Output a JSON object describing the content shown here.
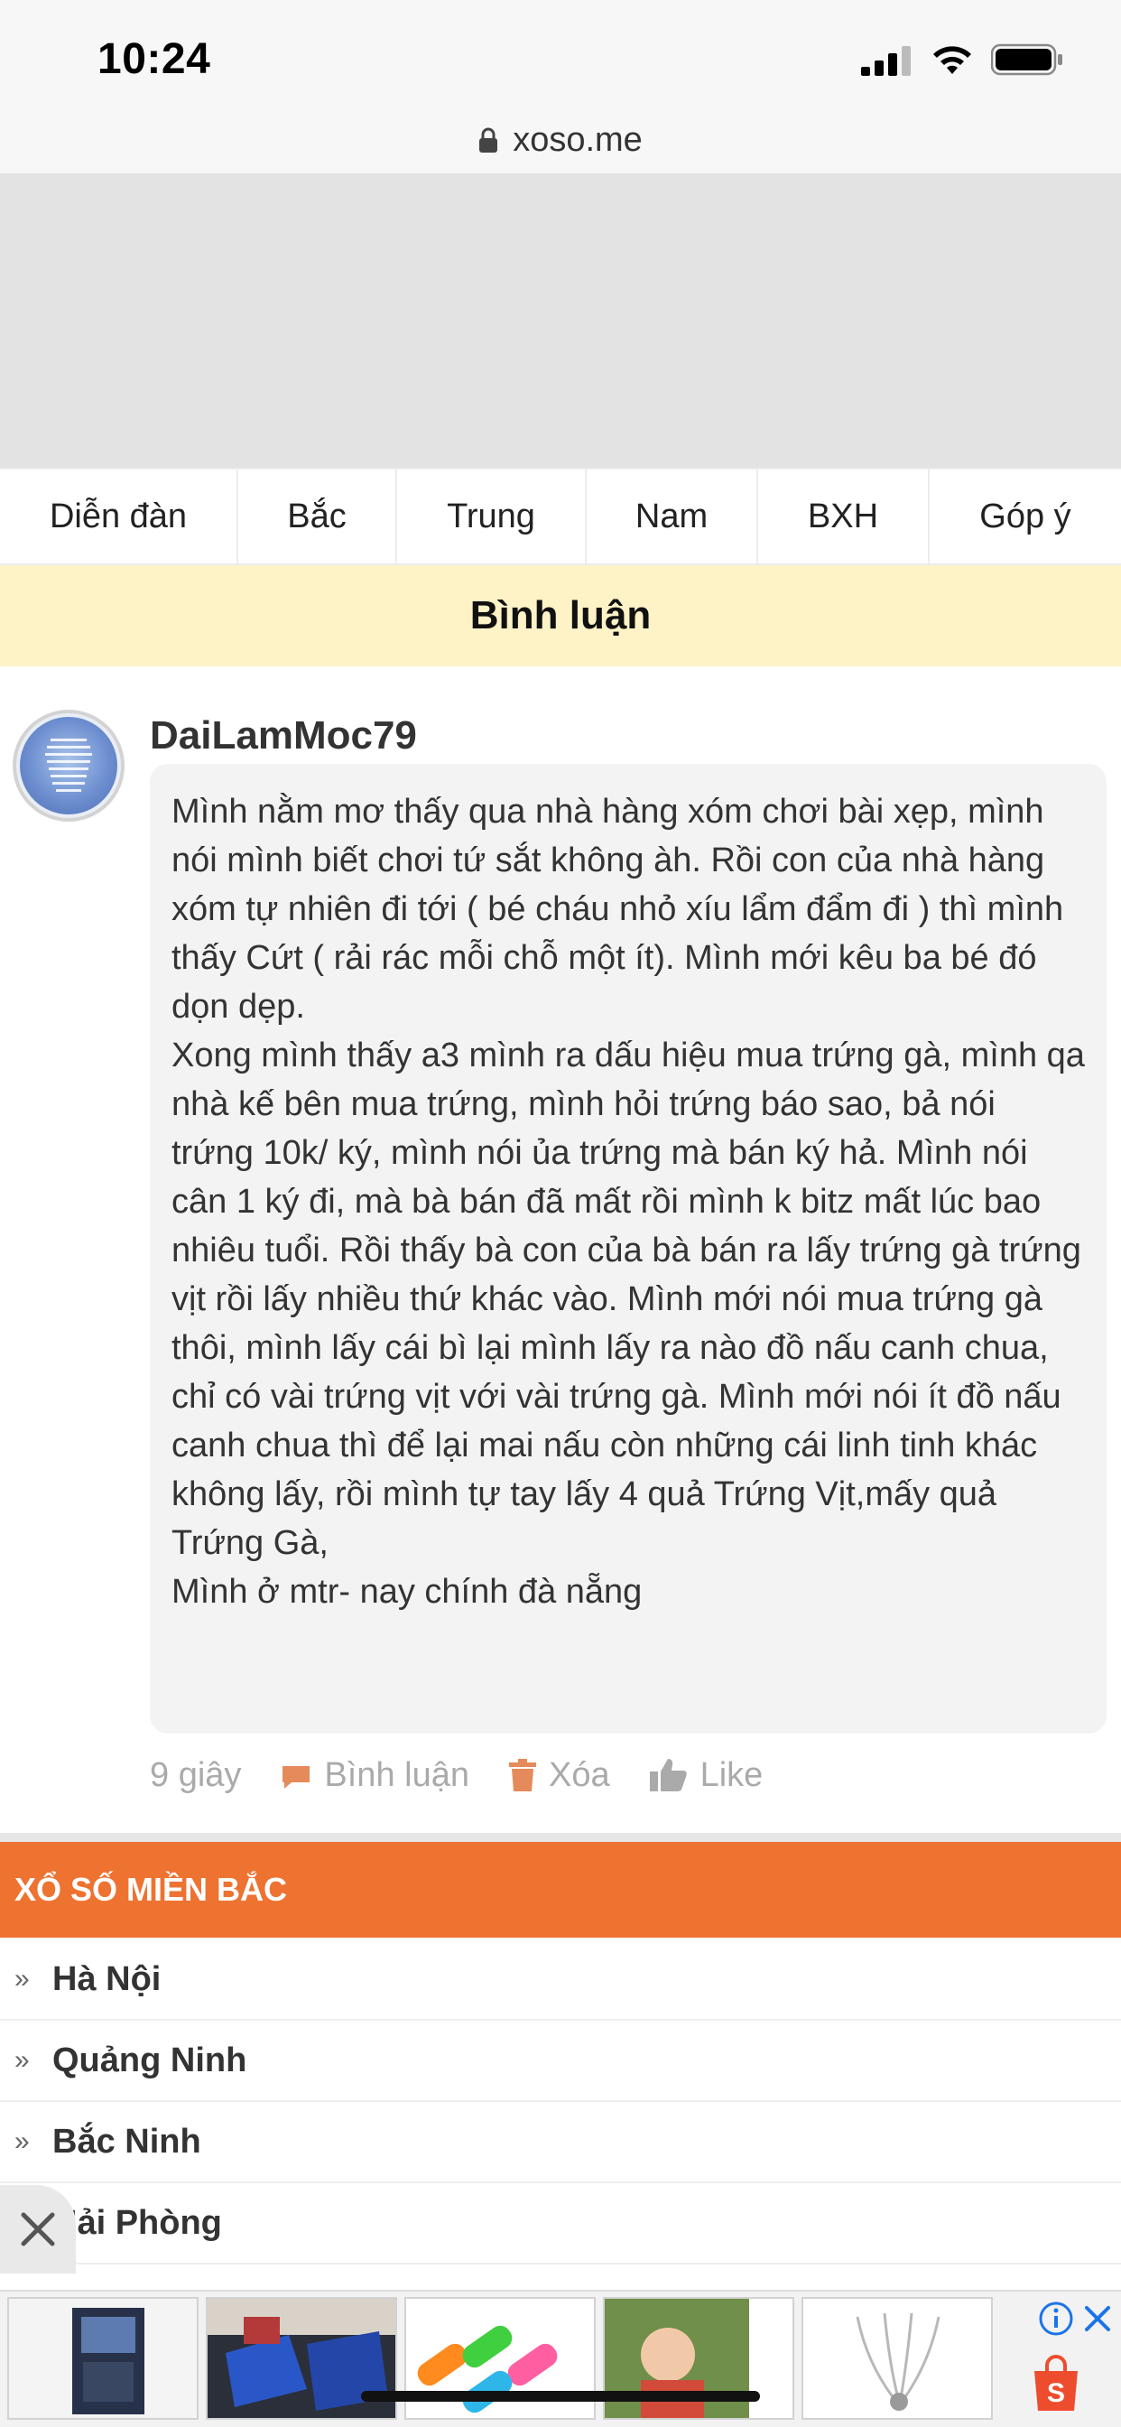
{
  "status_bar": {
    "time": "10:24"
  },
  "browser": {
    "url": "xoso.me"
  },
  "nav": {
    "items": [
      "Diễn đàn",
      "Bắc",
      "Trung",
      "Nam",
      "BXH",
      "Góp ý"
    ]
  },
  "section": {
    "title": "Bình luận"
  },
  "comment": {
    "username": "DaiLamMoc79",
    "text": "Mình nằm mơ thấy qua nhà hàng xóm chơi bài xẹp, mình nói mình biết chơi tứ sắt không àh. Rồi con của nhà hàng xóm tự nhiên đi tới ( bé cháu nhỏ xíu lẩm đẩm đi ) thì mình thấy Cứt ( rải rác mỗi chỗ một ít). Mình mới kêu ba bé đó dọn dẹp.\nXong mình thấy a3 mình ra dấu hiệu mua trứng gà, mình qa nhà kế bên mua trứng, mình hỏi trứng báo sao, bả nói trứng 10k/ ký, mình nói ủa trứng mà bán ký hả. Mình nói cân 1 ký đi, mà bà bán đã mất rồi mình k bitz mất lúc bao nhiêu tuổi. Rồi thấy bà con của bà bán ra lấy trứng gà trứng vịt rồi lấy nhiều thứ khác vào. Mình mới nói mua trứng gà thôi, mình lấy cái bì lại mình lấy ra nào đồ nấu canh chua, chỉ có vài trứng vịt với vài trứng gà. Mình mới nói ít đồ nấu canh chua thì để lại mai nấu còn những cái linh tinh khác không lấy, rồi mình tự tay lấy 4 quả Trứng Vịt,mấy quả Trứng Gà,\nMình ở mtr- nay chính đà nẵng",
    "time_ago": "9 giây",
    "reply_label": "Bình luận",
    "delete_label": "Xóa",
    "like_label": "Like"
  },
  "region": {
    "title": "XỔ SỐ MIỀN BẮC",
    "provinces": [
      "Hà Nội",
      "Quảng Ninh",
      "Bắc Ninh",
      "Hải Phòng"
    ]
  },
  "colors": {
    "orange": "#ee7230",
    "section_bg": "#fdf3c7",
    "action_icon": "#e58a5a"
  }
}
